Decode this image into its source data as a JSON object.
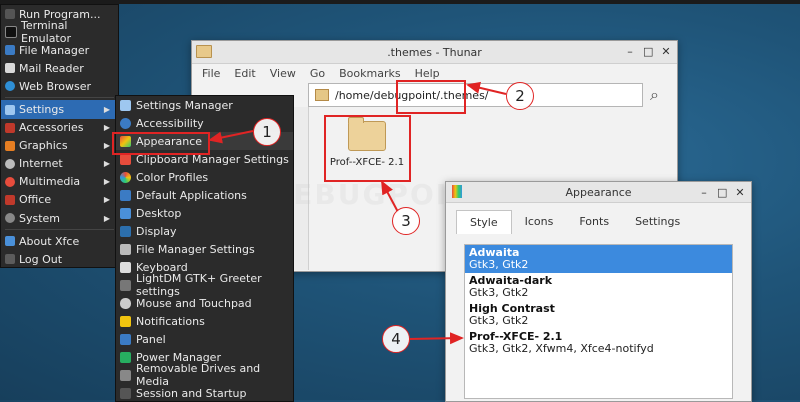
{
  "thunar": {
    "title": ".themes - Thunar",
    "menu": [
      "File",
      "Edit",
      "View",
      "Go",
      "Bookmarks",
      "Help"
    ],
    "location": "/home/debugpoint/.themes/",
    "file_name": "Prof--XFCE- 2.1"
  },
  "appearance": {
    "title": "Appearance",
    "tabs": [
      "Style",
      "Icons",
      "Fonts",
      "Settings"
    ],
    "styles": [
      {
        "name": "Adwaita",
        "desc": "Gtk3, Gtk2"
      },
      {
        "name": "Adwaita-dark",
        "desc": "Gtk3, Gtk2"
      },
      {
        "name": "High Contrast",
        "desc": "Gtk3, Gtk2"
      },
      {
        "name": "Prof--XFCE- 2.1",
        "desc": "Gtk3, Gtk2, Xfwm4, Xfce4-notifyd"
      }
    ]
  },
  "appmenu": {
    "items": [
      "Run Program...",
      "Terminal Emulator",
      "File Manager",
      "Mail Reader",
      "Web Browser",
      "Settings",
      "Accessories",
      "Graphics",
      "Internet",
      "Multimedia",
      "Office",
      "System",
      "About Xfce",
      "Log Out"
    ]
  },
  "settings_menu": {
    "items": [
      "Settings Manager",
      "Accessibility",
      "Appearance",
      "Clipboard Manager Settings",
      "Color Profiles",
      "Default Applications",
      "Desktop",
      "Display",
      "File Manager Settings",
      "Keyboard",
      "LightDM GTK+ Greeter settings",
      "Mouse and Touchpad",
      "Notifications",
      "Panel",
      "Power Manager",
      "Removable Drives and Media",
      "Session and Startup"
    ]
  },
  "annotations": [
    "1",
    "2",
    "3",
    "4"
  ],
  "watermark": "DEBUGPOINT.COM",
  "colors": {
    "accent": "#e02424",
    "selection": "#3c8ade",
    "menu_bg": "#2b2b2b"
  }
}
